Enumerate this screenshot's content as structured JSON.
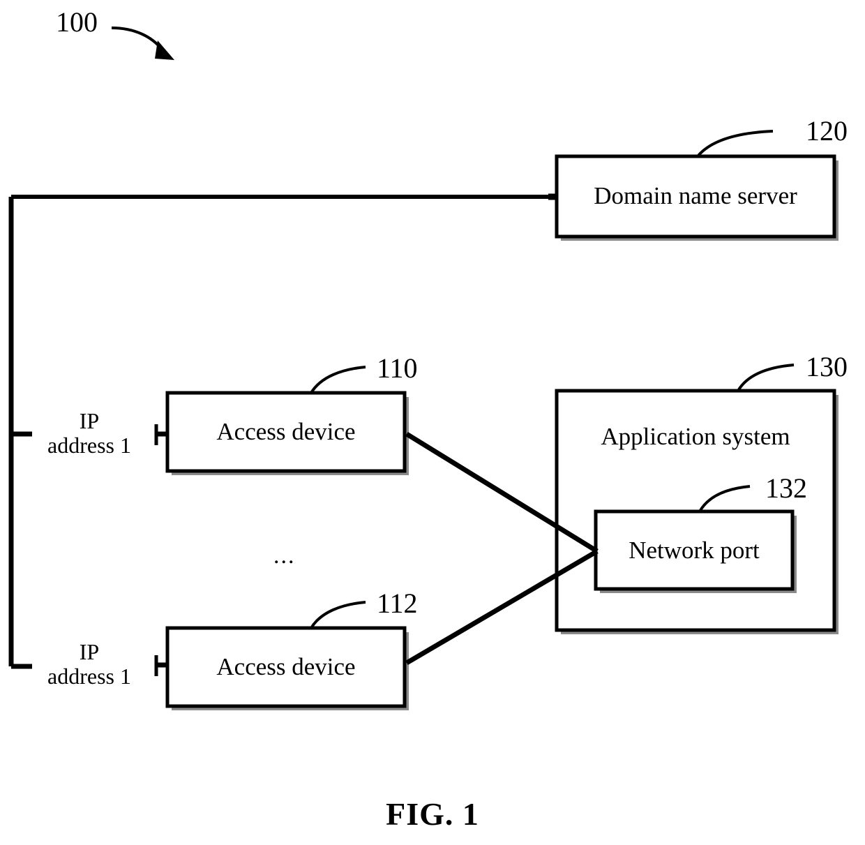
{
  "figure": {
    "caption": "FIG. 1",
    "system_ref": "100"
  },
  "nodes": {
    "domain_name_server": {
      "label": "Domain name server",
      "ref": "120"
    },
    "access_device_1": {
      "label": "Access device",
      "ref": "110",
      "address_label_line1": "IP",
      "address_label_line2": "address 1"
    },
    "access_device_2": {
      "label": "Access device",
      "ref": "112",
      "address_label_line1": "IP",
      "address_label_line2": "address 1"
    },
    "application_system": {
      "label": "Application system",
      "ref": "130"
    },
    "network_port": {
      "label": "Network port",
      "ref": "132"
    }
  },
  "separator": {
    "ellipsis": "..."
  },
  "colors": {
    "stroke": "#000000",
    "shadow": "#8a8a8a",
    "background": "#ffffff"
  },
  "diagram_data": {
    "type": "block-diagram",
    "title": "FIG. 1",
    "blocks": [
      {
        "id": "120",
        "name": "Domain name server"
      },
      {
        "id": "110",
        "name": "Access device"
      },
      {
        "id": "112",
        "name": "Access device"
      },
      {
        "id": "130",
        "name": "Application system"
      },
      {
        "id": "132",
        "name": "Network port",
        "parent": "130"
      }
    ],
    "connections": [
      {
        "from": "bus",
        "to": "120"
      },
      {
        "from": "bus",
        "to": "110"
      },
      {
        "from": "bus",
        "to": "112"
      },
      {
        "from": "110",
        "to": "132"
      },
      {
        "from": "112",
        "to": "132"
      }
    ]
  }
}
